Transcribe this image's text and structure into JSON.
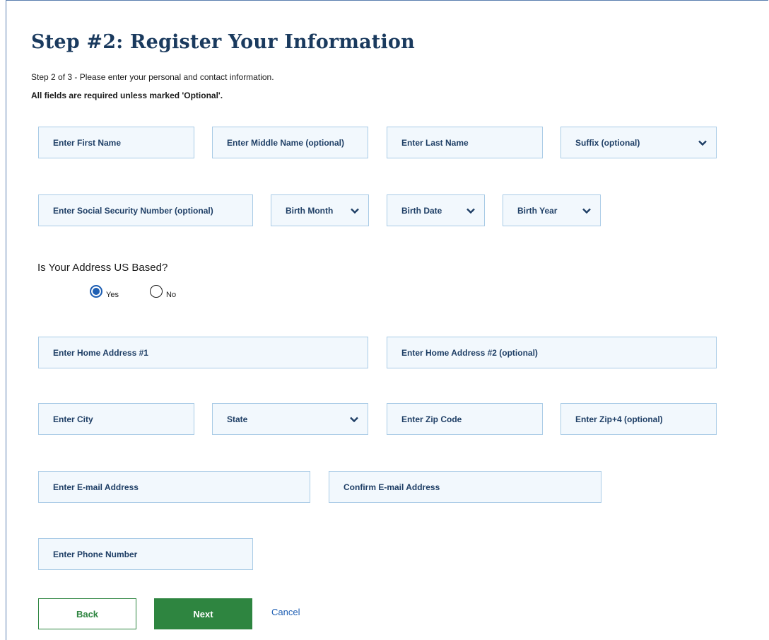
{
  "page": {
    "title": "Step #2: Register Your Information",
    "subtitle": "Step 2 of 3 - Please enter your personal and contact information.",
    "required_note": "All fields are required unless marked 'Optional'."
  },
  "name_fields": {
    "first_name": "Enter First Name",
    "middle_name": "Enter Middle Name (optional)",
    "last_name": "Enter Last Name",
    "suffix": "Suffix (optional)"
  },
  "id_fields": {
    "ssn": "Enter Social Security Number (optional)",
    "birth_month": "Birth Month",
    "birth_date": "Birth Date",
    "birth_year": "Birth Year"
  },
  "address_question": {
    "label": "Is Your Address US Based?",
    "yes_label": "Yes",
    "no_label": "No",
    "selected": "Yes"
  },
  "address_fields": {
    "address1": "Enter Home Address #1",
    "address2": "Enter Home Address #2 (optional)",
    "city": "Enter City",
    "state": "State",
    "zip": "Enter Zip Code",
    "zip4": "Enter Zip+4 (optional)"
  },
  "contact_fields": {
    "email": "Enter E-mail Address",
    "confirm_email": "Confirm E-mail Address",
    "phone": "Enter Phone Number"
  },
  "actions": {
    "back": "Back",
    "next": "Next",
    "cancel": "Cancel"
  },
  "colors": {
    "title": "#1a3a5e",
    "field_bg": "#f2f8fd",
    "field_border": "#a9cbe6",
    "primary_button": "#2e8540",
    "link": "#1f5fb3"
  },
  "icons": {
    "select_caret": "chevron-down-icon",
    "radio_selected": "radio-selected-icon",
    "radio_unselected": "radio-unselected-icon"
  }
}
